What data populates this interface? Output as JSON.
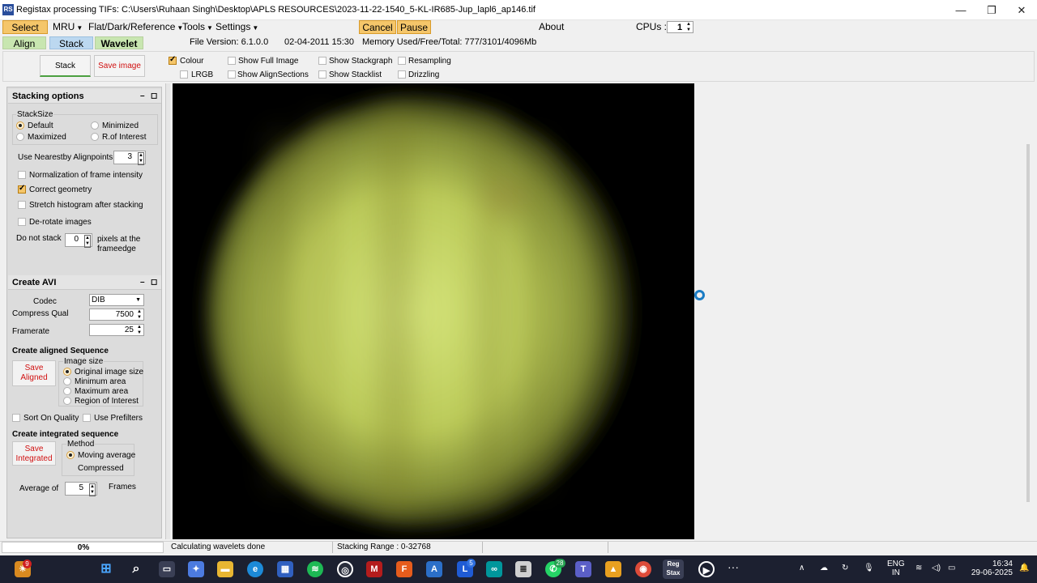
{
  "window": {
    "app_icon": "RS",
    "title": "Registax processing TIFs: C:\\Users\\Ruhaan Singh\\Desktop\\APLS RESOURCES\\2023-11-22-1540_5-KL-IR685-Jup_lapl6_ap146.tif",
    "min": "—",
    "max": "❐",
    "close": "✕"
  },
  "menu": {
    "select": "Select",
    "mru": "MRU",
    "flat": "Flat/Dark/Reference",
    "tools": "Tools",
    "settings": "Settings",
    "cancel": "Cancel",
    "pause": "Pause",
    "about": "About",
    "cpus_label": "CPUs :",
    "cpus_value": "1"
  },
  "tabs": {
    "align": "Align",
    "stack": "Stack",
    "wavelet": "Wavelet"
  },
  "fileinfo": {
    "version": "File Version: 6.1.0.0",
    "date": "02-04-2011 15:30",
    "memory": "Memory Used/Free/Total: 777/3101/4096Mb"
  },
  "toolbar": {
    "stack_btn": "Stack",
    "save_image_btn": "Save image",
    "colour": "Colour",
    "lrgb": "LRGB",
    "show_full_image": "Show Full Image",
    "show_alignsections": "Show AlignSections",
    "show_stackgraph": "Show Stackgraph",
    "show_stacklist": "Show Stacklist",
    "resampling": "Resampling",
    "drizzling": "Drizzling"
  },
  "stacking": {
    "header": "Stacking options",
    "stacksize_label": "StackSize",
    "default": "Default",
    "minimized": "Minimized",
    "maximized": "Maximized",
    "roi": "R.of Interest",
    "nearest_label": "Use Nearestby Alignpoints",
    "nearest_value": "3",
    "normalization": "Normalization of frame intensity",
    "correct_geometry": "Correct geometry",
    "stretch": "Stretch histogram after stacking",
    "derotate": "De-rotate images",
    "do_not_stack": "Do not stack",
    "do_not_stack_value": "0",
    "pixels_at": "pixels at the",
    "frameedge": "frameedge"
  },
  "avi": {
    "header": "Create AVI",
    "codec_label": "Codec",
    "codec_value": "DIB",
    "compress_label": "Compress Qual",
    "compress_value": "7500",
    "framerate_label": "Framerate",
    "framerate_value": "25",
    "aligned_seq": "Create aligned Sequence",
    "save_aligned_1": "Save",
    "save_aligned_2": "Aligned",
    "image_size": "Image size",
    "original": "Original image size",
    "minimum": "Minimum area",
    "maximum": "Maximum area",
    "region": "Region of Interest",
    "sort_quality": "Sort On Quality",
    "use_prefilters": "Use Prefilters",
    "integrated_seq": "Create integrated sequence",
    "save_int_1": "Save",
    "save_int_2": "Integrated",
    "method": "Method",
    "moving_avg": "Moving average",
    "compressed": "Compressed",
    "average_of": "Average of",
    "average_value": "5",
    "frames": "Frames"
  },
  "status": {
    "progress": "0%",
    "progress_fraction": 0,
    "message": "Calculating wavelets done",
    "range": "Stacking Range : 0-32768"
  },
  "taskbar": {
    "badge_weather": "9",
    "badge_l": "5",
    "badge_whatsapp": "28",
    "lang1": "ENG",
    "lang2": "IN",
    "time": "16:34",
    "date": "29-06-2025",
    "more": "···",
    "up": "∧"
  },
  "colors": {
    "orange": "#f5c66a",
    "tab_blue": "#bcd8f0",
    "wavelet_tab": "#c8e6b0",
    "planet": "#c8d86a",
    "taskbar": "#1c2030"
  }
}
